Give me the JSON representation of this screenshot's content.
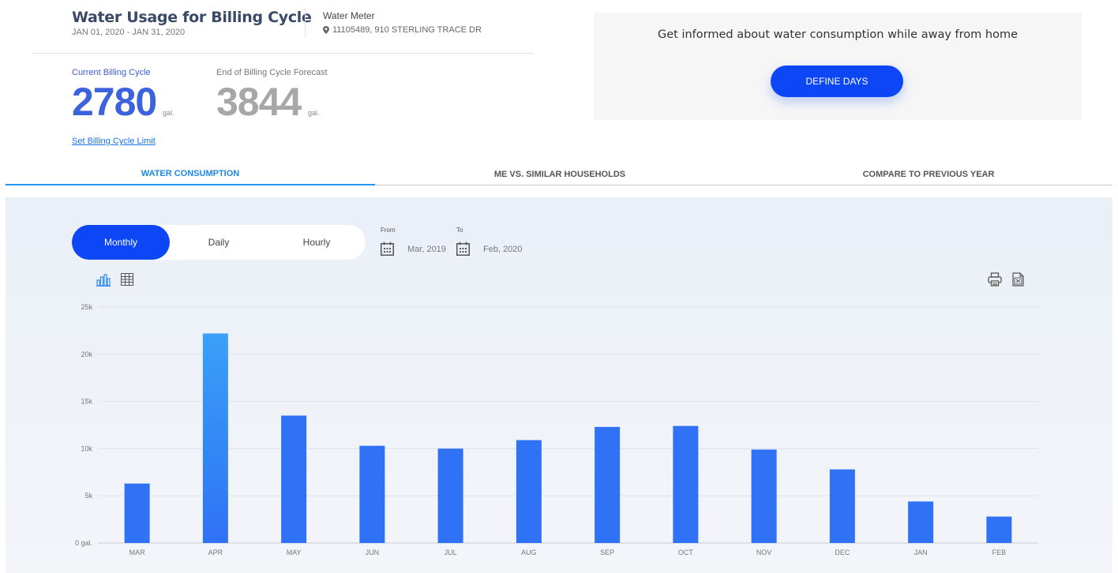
{
  "summary": {
    "title": "Water Usage for Billing Cycle",
    "date_range": "JAN 01, 2020 - JAN 31, 2020",
    "meter_label": "Water Meter",
    "meter_address": "11105489, 910 STERLING TRACE DR",
    "current_label": "Current Billing Cycle",
    "current_value": "2780",
    "current_unit": "gal.",
    "forecast_label": "End of Billing Cycle Forecast",
    "forecast_value": "3844",
    "forecast_unit": "gal.",
    "limit_link": "Set Billing Cycle Limit"
  },
  "promo": {
    "text": "Get informed about water consumption while away from home",
    "button": "DEFINE DAYS"
  },
  "tabs": [
    {
      "label": "WATER CONSUMPTION",
      "active": true
    },
    {
      "label": "ME VS. SIMILAR HOUSEHOLDS",
      "active": false
    },
    {
      "label": "COMPARE TO PREVIOUS YEAR",
      "active": false
    }
  ],
  "controls": {
    "periods": [
      "Monthly",
      "Daily",
      "Hourly"
    ],
    "selected_period": "Monthly",
    "from_label": "From",
    "from_value": "Mar, 2019",
    "to_label": "To",
    "to_value": "Feb, 2020"
  },
  "icons": {
    "chart_view": "bar-chart-icon",
    "table_view": "table-icon",
    "print": "print-icon",
    "export": "excel-icon",
    "location": "map-pin-icon",
    "calendar": "calendar-icon"
  },
  "colors": {
    "accent": "#0d47f5",
    "bar": "#2f72f5",
    "bar_highlight": "#3aa0f7",
    "tab_active": "#1e88e5"
  },
  "chart_data": {
    "type": "bar",
    "categories": [
      "MAR",
      "APR",
      "MAY",
      "JUN",
      "JUL",
      "AUG",
      "SEP",
      "OCT",
      "NOV",
      "DEC",
      "JAN",
      "FEB"
    ],
    "values": [
      6300,
      22200,
      13500,
      10300,
      10000,
      10900,
      12300,
      12400,
      9900,
      7800,
      4400,
      2800
    ],
    "y_ticks": [
      "0 gal.",
      "5k",
      "10k",
      "15k",
      "20k",
      "25k"
    ],
    "ylim": [
      0,
      25000
    ],
    "grid": true,
    "legend": "none"
  }
}
